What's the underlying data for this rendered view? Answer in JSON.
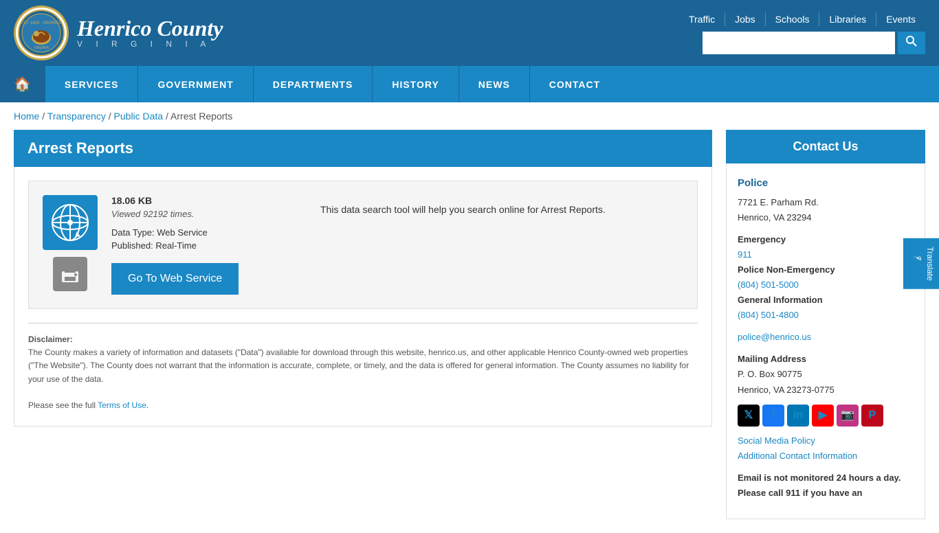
{
  "header": {
    "logo_county": "Henrico County",
    "logo_virginia": "V I R G I N I A",
    "top_links": [
      "Traffic",
      "Jobs",
      "Schools",
      "Libraries",
      "Events"
    ],
    "search_placeholder": ""
  },
  "nav": {
    "home_icon": "🏠",
    "items": [
      "Services",
      "Government",
      "Departments",
      "History",
      "News",
      "Contact"
    ]
  },
  "breadcrumb": {
    "home": "Home",
    "transparency": "Transparency",
    "public_data": "Public Data",
    "current": "Arrest Reports"
  },
  "page": {
    "title": "Arrest Reports",
    "file_size": "18.06 KB",
    "viewed": "Viewed 92192 times.",
    "data_type_label": "Data Type:",
    "data_type_value": "Web Service",
    "published_label": "Published:",
    "published_value": "Real-Time",
    "go_btn": "Go To Web Service",
    "description": "This data search tool will help you search online for Arrest Reports.",
    "disclaimer_title": "Disclaimer:",
    "disclaimer_text": "The County makes a variety of information and datasets (\"Data\") available for download through this website, henrico.us, and other applicable Henrico County-owned web properties (\"The Website\"). The County does not warrant that the information is accurate, complete, or timely, and the data is offered for general information. The County assumes no liability for your use of the data.",
    "disclaimer_terms_prefix": "Please see the full ",
    "disclaimer_terms_link": "Terms of Use",
    "disclaimer_terms_suffix": "."
  },
  "sidebar": {
    "contact_title": "Contact Us",
    "org_name": "Police",
    "address_line1": "7721 E. Parham Rd.",
    "address_line2": "Henrico, VA 23294",
    "emergency_label": "Emergency",
    "emergency_number": "911",
    "non_emergency_label": "Police Non-Emergency",
    "non_emergency_number": "(804) 501-5000",
    "general_info_label": "General Information",
    "general_info_number": "(804) 501-4800",
    "email": "police@henrico.us",
    "mailing_label": "Mailing Address",
    "mailing_line1": "P. O. Box 90775",
    "mailing_line2": "Henrico, VA 23273-0775",
    "social_policy": "Social Media Policy",
    "additional_contact": "Additional Contact Information",
    "email_notice": "Email is not monitored 24 hours a day. Please call 911 if you have an"
  },
  "translate_label": "Translate"
}
